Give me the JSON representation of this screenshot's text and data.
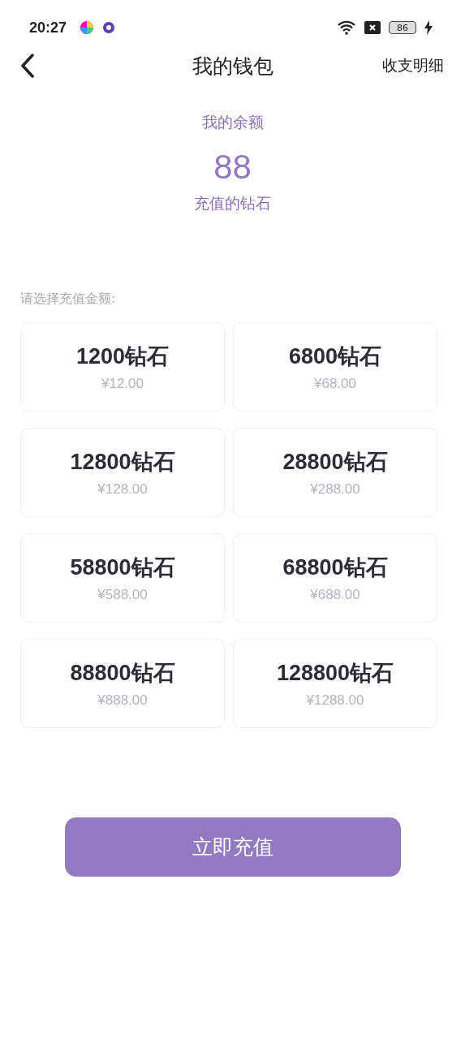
{
  "status_bar": {
    "time": "20:27",
    "battery": "86"
  },
  "nav": {
    "title": "我的钱包",
    "action": "收支明细"
  },
  "balance": {
    "label": "我的余额",
    "amount": "88",
    "unit": "充值的钻石"
  },
  "prompt": "请选择充值金额:",
  "packages": [
    {
      "diamonds": "1200钻石",
      "price": "¥12.00"
    },
    {
      "diamonds": "6800钻石",
      "price": "¥68.00"
    },
    {
      "diamonds": "12800钻石",
      "price": "¥128.00"
    },
    {
      "diamonds": "28800钻石",
      "price": "¥288.00"
    },
    {
      "diamonds": "58800钻石",
      "price": "¥588.00"
    },
    {
      "diamonds": "68800钻石",
      "price": "¥688.00"
    },
    {
      "diamonds": "88800钻石",
      "price": "¥888.00"
    },
    {
      "diamonds": "128800钻石",
      "price": "¥1288.00"
    }
  ],
  "button": "立即充值"
}
